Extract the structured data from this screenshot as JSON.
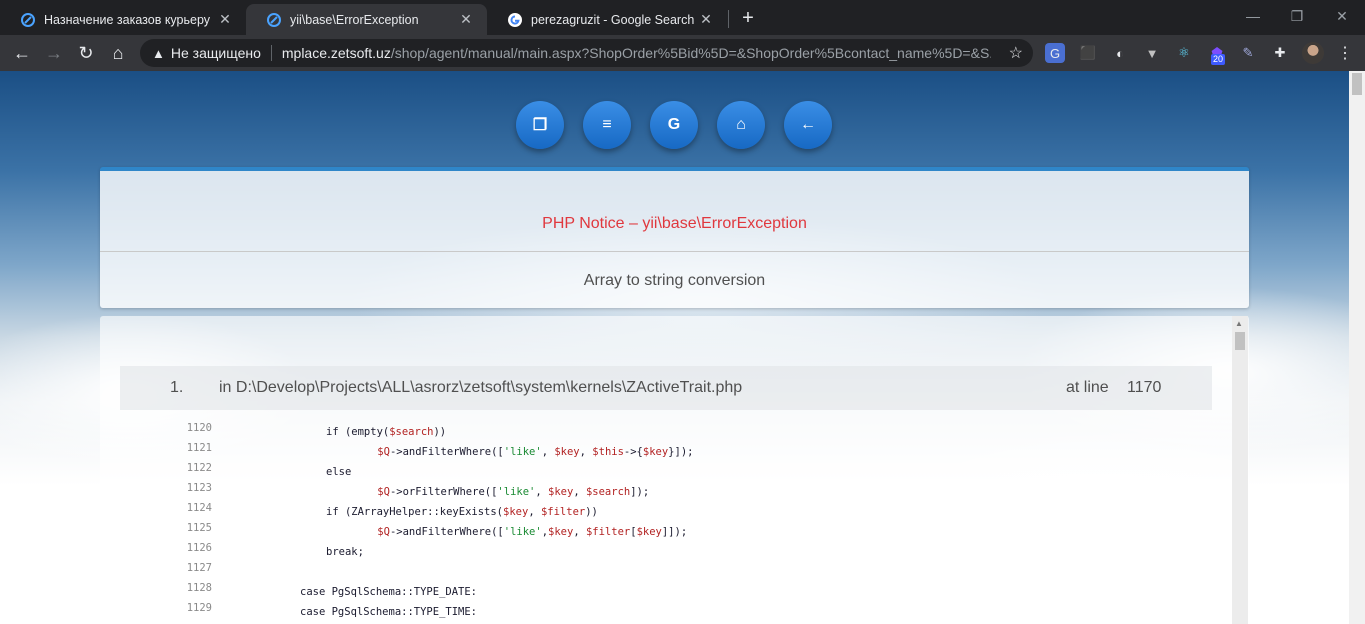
{
  "tabs": [
    {
      "title": "Назначение заказов курьеру",
      "icon": "zetsoft-icon",
      "active": false
    },
    {
      "title": "yii\\base\\ErrorException",
      "icon": "zetsoft-icon",
      "active": true
    },
    {
      "title": "perezagruzit - Google Search",
      "icon": "google-icon",
      "active": false
    }
  ],
  "tab_close": "✕",
  "new_tab": "+",
  "window": {
    "minimize": "—",
    "restore": "❐",
    "close": "✕"
  },
  "nav": {
    "back": "←",
    "forward": "→",
    "reload": "↻",
    "home": "⌂"
  },
  "omnibox": {
    "security_icon": "▲",
    "security_text": "Не защищено",
    "host": "mplace.zetsoft.uz",
    "path": "/shop/agent/manual/main.aspx?ShopOrder%5Bid%5D=&ShopOrder%5Bcontact_name%5D=&S..."
  },
  "extensions": {
    "badge": "20"
  },
  "toolbar_icons": [
    "copy-icon",
    "stack-overflow-icon",
    "google-icon",
    "home-icon",
    "arrow-left-icon"
  ],
  "toolbar_glyphs": [
    "❐",
    "≡",
    "G",
    "⌂",
    "←"
  ],
  "error": {
    "title": "PHP Notice – yii\\base\\ErrorException",
    "message": "Array to string conversion"
  },
  "frame": {
    "number": "1.",
    "file": "in D:\\Develop\\Projects\\ALL\\asrorz\\zetsoft\\system\\kernels\\ZActiveTrait.php",
    "at_line_label": "at line",
    "line": "1170"
  },
  "code_lines": [
    {
      "n": "1120",
      "code": "if (empty($search))"
    },
    {
      "n": "1121",
      "code": "    $Q->andFilterWhere(['like', $key, $this->{$key}]);"
    },
    {
      "n": "1122",
      "code": "else"
    },
    {
      "n": "1123",
      "code": "    $Q->orFilterWhere(['like', $key, $search]);"
    },
    {
      "n": "1124",
      "code": "if (ZArrayHelper::keyExists($key, $filter))"
    },
    {
      "n": "1125",
      "code": "    $Q->andFilterWhere(['like',$key, $filter[$key]]);"
    },
    {
      "n": "1126",
      "code": "break;"
    },
    {
      "n": "1127",
      "code": ""
    },
    {
      "n": "1128",
      "code": "case PgSqlSchema::TYPE_DATE:"
    },
    {
      "n": "1129",
      "code": "case PgSqlSchema::TYPE_TIME:"
    }
  ],
  "colors": {
    "error_red": "#e0383e",
    "accent_blue": "#2f86c9",
    "button_blue": "#1e78d6"
  }
}
